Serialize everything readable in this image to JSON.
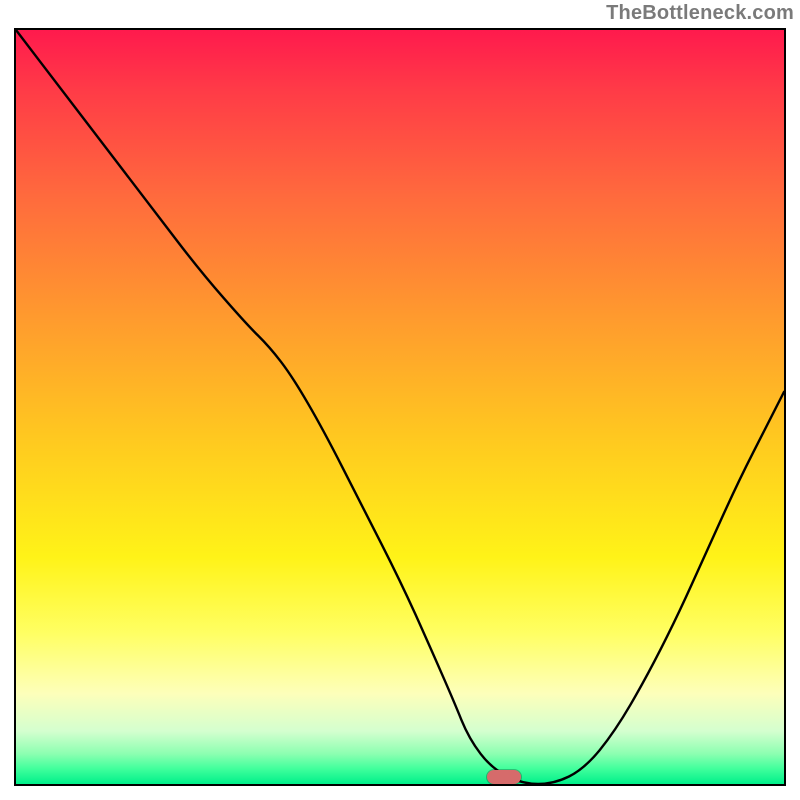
{
  "attribution": "TheBottleneck.com",
  "colors": {
    "gradient_top": "#ff1a4d",
    "gradient_bottom": "#00f08a",
    "marker": "#d66b6b",
    "curve": "#000000",
    "frame": "#000000"
  },
  "chart_data": {
    "type": "line",
    "title": "",
    "xlabel": "",
    "ylabel": "",
    "xlim": [
      0,
      100
    ],
    "ylim": [
      0,
      100
    ],
    "grid": false,
    "legend": false,
    "series": [
      {
        "name": "bottleneck-curve",
        "x": [
          0,
          6,
          12,
          18,
          24,
          30,
          33,
          36,
          40,
          45,
          50,
          54,
          57,
          59,
          62,
          66,
          70,
          74,
          78,
          82,
          86,
          90,
          94,
          98,
          100
        ],
        "y": [
          100,
          92,
          84,
          76,
          68,
          61,
          58,
          54,
          47,
          37,
          27,
          18,
          11,
          6,
          2,
          0,
          0,
          2,
          7,
          14,
          22,
          31,
          40,
          48,
          52
        ]
      }
    ],
    "marker": {
      "name": "optimal-point",
      "x": 63.5,
      "y": 0,
      "width_pct": 4.4,
      "height_pct": 1.9
    }
  }
}
